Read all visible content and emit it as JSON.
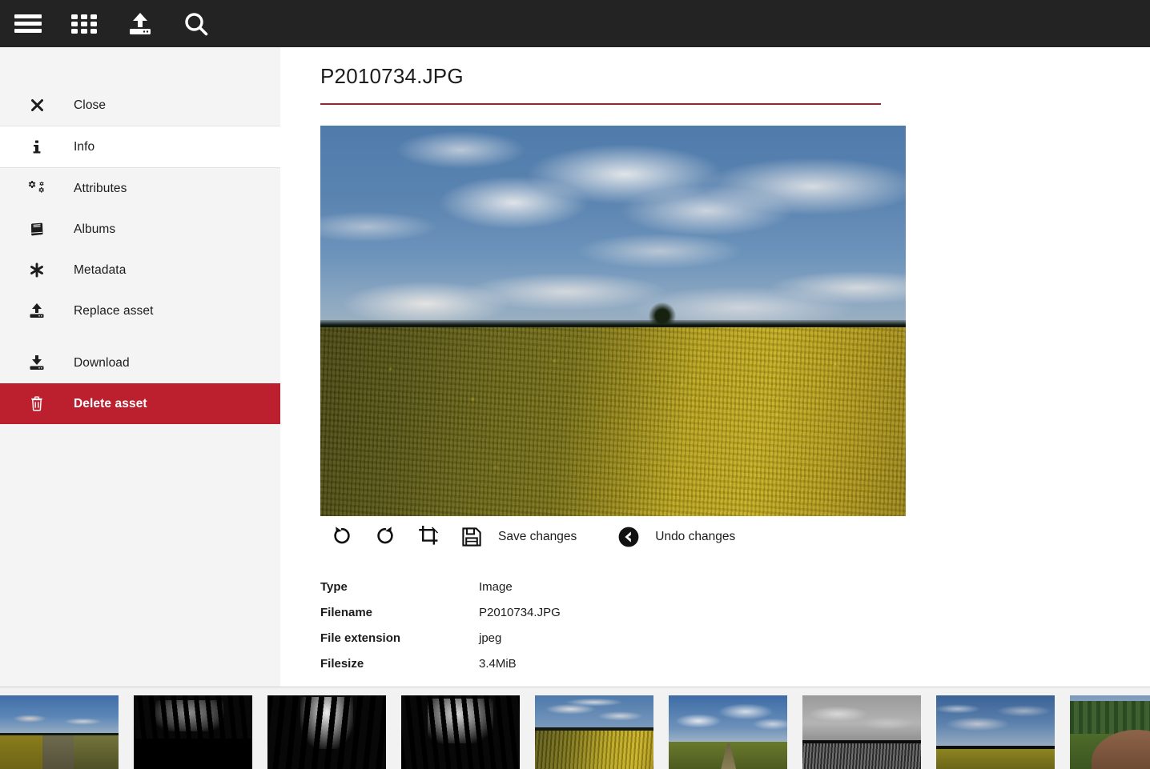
{
  "topbar": {
    "buttons": [
      {
        "name": "menu-icon",
        "label": "Menu"
      },
      {
        "name": "grid-icon",
        "label": "Browse"
      },
      {
        "name": "upload-icon",
        "label": "Upload"
      },
      {
        "name": "search-icon",
        "label": "Search"
      }
    ],
    "background": "#232323"
  },
  "sidebar": {
    "items": [
      {
        "label": "Close",
        "icon": "close-icon",
        "state": "normal"
      },
      {
        "label": "Info",
        "icon": "info-icon",
        "state": "active"
      },
      {
        "label": "Attributes",
        "icon": "gears-icon",
        "state": "normal"
      },
      {
        "label": "Albums",
        "icon": "book-icon",
        "state": "normal"
      },
      {
        "label": "Metadata",
        "icon": "asterisk-icon",
        "state": "normal"
      },
      {
        "label": "Replace asset",
        "icon": "upload-icon",
        "state": "normal"
      },
      {
        "label": "Download",
        "icon": "download-icon",
        "state": "normal"
      },
      {
        "label": "Delete asset",
        "icon": "trash-icon",
        "state": "danger"
      }
    ],
    "danger_color": "#bc202f",
    "background": "#f4f4f4"
  },
  "main": {
    "title": "P2010734.JPG",
    "rule_color": "#a81e2d",
    "edit_toolbar": [
      {
        "name": "rotate-left-icon",
        "label": ""
      },
      {
        "name": "rotate-right-icon",
        "label": ""
      },
      {
        "name": "crop-icon",
        "label": ""
      },
      {
        "name": "save-icon",
        "label": "Save changes"
      },
      {
        "name": "undo-icon",
        "label": "Undo changes"
      }
    ],
    "save_label": "Save changes",
    "undo_label": "Undo changes",
    "metadata": [
      {
        "key": "Type",
        "value": "Image"
      },
      {
        "key": "Filename",
        "value": "P2010734.JPG"
      },
      {
        "key": "File extension",
        "value": "jpeg"
      },
      {
        "key": "Filesize",
        "value": "3.4MiB"
      }
    ]
  },
  "filmstrip": {
    "selected_index": 4,
    "selected_color": "#d02030",
    "thumbnails": [
      {
        "art": "track",
        "selected": false
      },
      {
        "art": "forest1",
        "selected": false
      },
      {
        "art": "forest2",
        "selected": false
      },
      {
        "art": "forest3",
        "selected": false
      },
      {
        "art": "rape",
        "selected": true
      },
      {
        "art": "path",
        "selected": false
      },
      {
        "art": "mono",
        "selected": false
      },
      {
        "art": "storm",
        "selected": false
      },
      {
        "art": "pile",
        "selected": false
      }
    ]
  }
}
